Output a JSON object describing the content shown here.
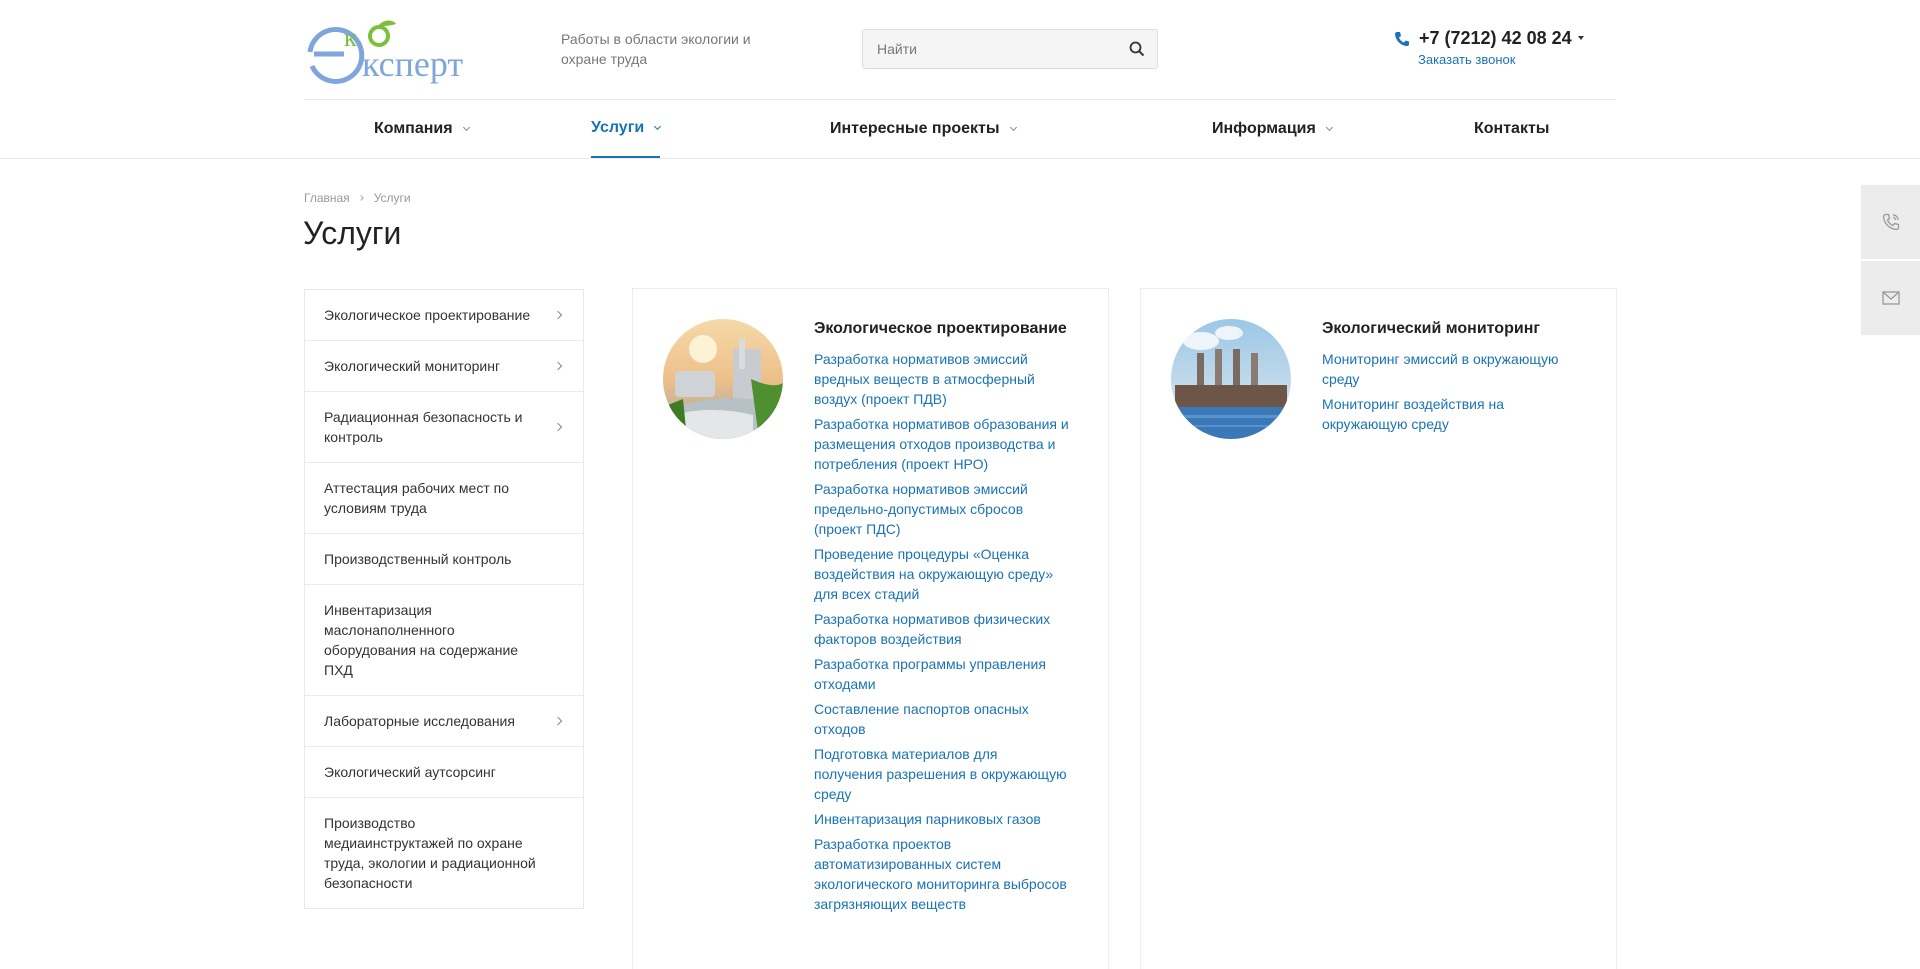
{
  "header": {
    "slogan": "Работы в области экологии и охране труда",
    "search_placeholder": "Найти",
    "phone": "+7 (7212) 42 08 24",
    "callback": "Заказать звонок"
  },
  "colors": {
    "accent": "#1a73b5",
    "logo_blue": "#7fa6da",
    "logo_green": "#7cbf3a"
  },
  "nav": [
    {
      "label": "Компания",
      "active": false
    },
    {
      "label": "Услуги",
      "active": true
    },
    {
      "label": "Интересные проекты",
      "active": false
    },
    {
      "label": "Информация",
      "active": false
    },
    {
      "label": "Контакты",
      "active": false
    }
  ],
  "breadcrumb": {
    "home": "Главная",
    "current": "Услуги"
  },
  "page_title": "Услуги",
  "sidebar": [
    {
      "label": "Экологическое проектирование"
    },
    {
      "label": "Экологический мониторинг"
    },
    {
      "label": "Радиационная безопасность и контроль"
    },
    {
      "label": "Аттестация рабочих мест по условиям труда"
    },
    {
      "label": "Производственный контроль"
    },
    {
      "label": "Инвентаризация маслонаполненного оборудования на содержание ПХД"
    },
    {
      "label": "Лабораторные исследования"
    },
    {
      "label": "Экологический аутсорсинг"
    },
    {
      "label": "Производство медиаинструктажей по охране труда, экологии и радиационной безопасности"
    }
  ],
  "cards": [
    {
      "title": "Экологическое проектирование",
      "links": [
        "Разработка нормативов эмиссий вредных веществ в атмосферный воздух (проект ПДВ)",
        "Разработка нормативов образования и размещения отходов производства и потребления (проект НРО)",
        "Разработка нормативов эмиссий предельно-допустимых сбросов (проект ПДС)",
        "Проведение процедуры «Оценка воздействия на окружающую среду» для всех стадий",
        "Разработка нормативов физических факторов воздействия",
        "Разработка программы управления отходами",
        "Составление паспортов опасных отходов",
        "Подготовка материалов для получения разрешения в окружающую среду",
        "Инвентаризация парниковых газов",
        "Разработка проектов автоматизированных систем экологического мониторинга выбросов загрязняющих веществ"
      ]
    },
    {
      "title": "Экологический мониторинг",
      "links": [
        "Мониторинг эмиссий в окружающую среду",
        "Мониторинг воздействия на окружающую среду"
      ]
    }
  ],
  "icons": {
    "search": "search-icon",
    "phone": "phone-icon",
    "float_call": "phone-icon",
    "float_mail": "mail-icon"
  }
}
